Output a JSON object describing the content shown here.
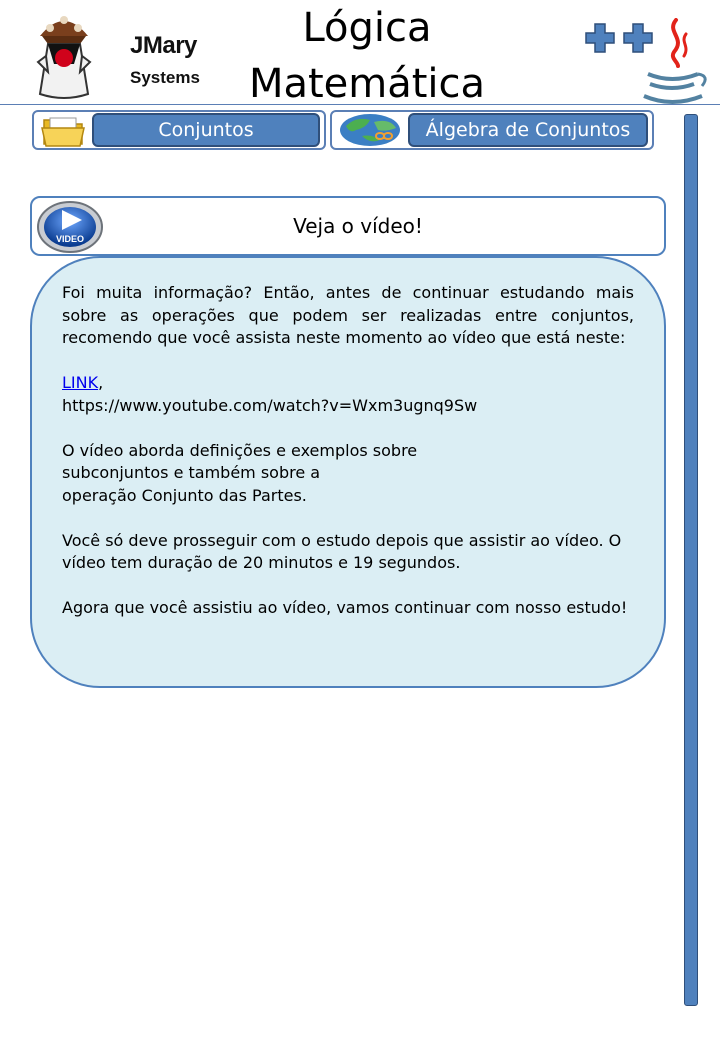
{
  "logo": {
    "brand_line1": "JMary",
    "brand_line2": "Systems"
  },
  "title": {
    "line1": "Lógica",
    "line2": "Matemática"
  },
  "nav": {
    "conjuntos_label": "Conjuntos",
    "algebra_label": "Álgebra de Conjuntos"
  },
  "video": {
    "header_title": "Veja o vídeo!",
    "icon_text": "VIDEO"
  },
  "content": {
    "intro": "Foi muita informação? Então, antes de continuar estudando mais sobre as operações que podem ser realizadas entre conjuntos, recomendo que você assista neste momento ao vídeo que está neste:",
    "link_text": "LINK",
    "link_suffix": ",",
    "url": "https://www.youtube.com/watch?v=Wxm3ugnq9Sw",
    "about_line1": "O vídeo aborda definições e exemplos sobre",
    "about_line2": "subconjuntos e também sobre a",
    "about_line3": "operação Conjunto das Partes.",
    "duration": "Você só deve prosseguir com o estudo depois que assistir ao vídeo. O vídeo tem duração de 20 minutos e 19 segundos.",
    "closing": "Agora que você assistiu ao vídeo, vamos continuar com nosso estudo!"
  },
  "colors": {
    "accent": "#4f81bd",
    "accent_dark": "#2f4f7a",
    "content_bg": "#dbeef4",
    "link": "#0000ee"
  },
  "icons": {
    "logo": "duke-mascot-logo",
    "plus": "plus-icon",
    "java": "java-cup-icon",
    "folder": "folder-icon",
    "globe": "globe-icon",
    "video": "video-play-icon"
  }
}
